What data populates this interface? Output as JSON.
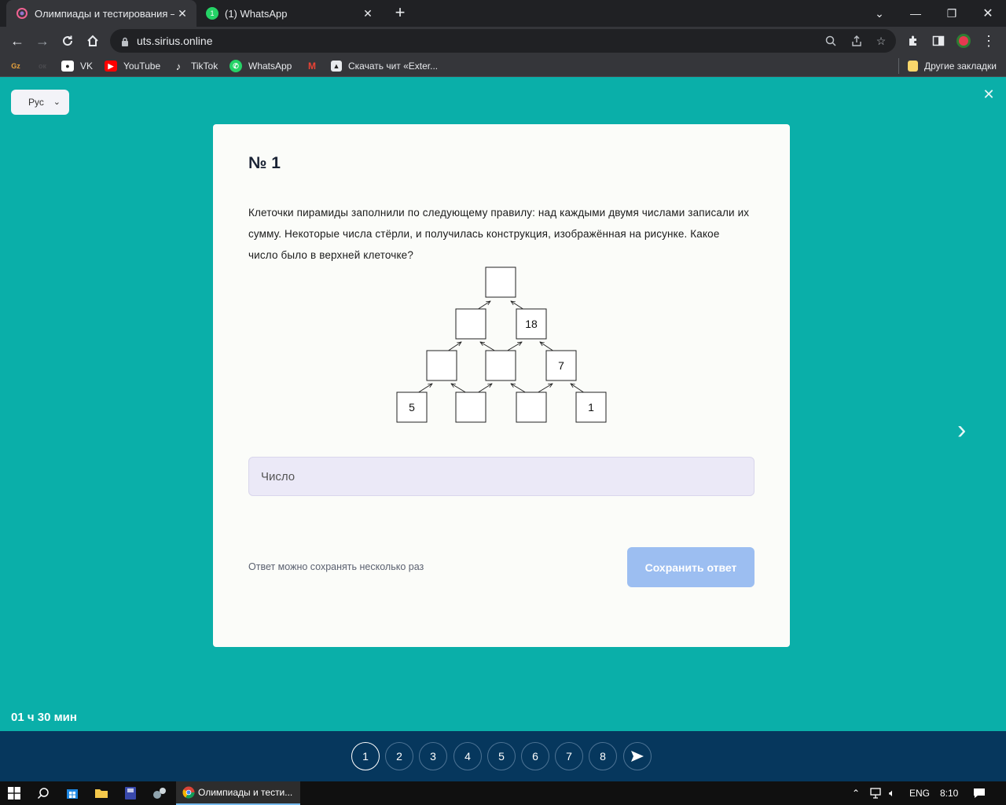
{
  "browser": {
    "tabs": [
      {
        "title": "Олимпиады и тестирования — ",
        "active": true
      },
      {
        "title": "(1) WhatsApp",
        "active": false
      }
    ],
    "url": "uts.sirius.online",
    "bookmarks": [
      {
        "label": "",
        "icon": "gz-icon"
      },
      {
        "label": "",
        "icon": "ok-icon"
      },
      {
        "label": "VK",
        "icon": "vk-icon"
      },
      {
        "label": "YouTube",
        "icon": "youtube-icon"
      },
      {
        "label": "TikTok",
        "icon": "tiktok-icon"
      },
      {
        "label": "WhatsApp",
        "icon": "whatsapp-icon"
      },
      {
        "label": "",
        "icon": "gmail-icon"
      },
      {
        "label": "Скачать чит «Exter...",
        "icon": "page-icon"
      }
    ],
    "other_bookmarks": "Другие закладки"
  },
  "page": {
    "language": "Рус",
    "question": {
      "number": "№ 1",
      "text": "Клеточки пирамиды заполнили по следующему правилу: над каждыми двумя числами записали их сумму. Некоторые числа стёрли, и получилась конструкция, изображённая на рисунке. Какое число было в верхней клеточке?"
    },
    "pyramid": {
      "row1": [
        ""
      ],
      "row2": [
        "",
        "18"
      ],
      "row3": [
        "",
        "",
        "7"
      ],
      "row4": [
        "5",
        "",
        "",
        "1"
      ]
    },
    "answer_placeholder": "Число",
    "hint": "Ответ можно сохранять несколько раз",
    "save_label": "Сохранить ответ",
    "timer": "01 ч 30 мин"
  },
  "question_nav": {
    "items": [
      "1",
      "2",
      "3",
      "4",
      "5",
      "6",
      "7",
      "8"
    ],
    "current": "1"
  },
  "taskbar": {
    "chrome_label": "Олимпиады и тести...",
    "language": "ENG",
    "time": "8:10"
  },
  "colors": {
    "page_bg": "#0aafa9",
    "nav_bg": "#06375d",
    "save_button": "#9cbef1",
    "answer_field": "#ebe9f7"
  }
}
